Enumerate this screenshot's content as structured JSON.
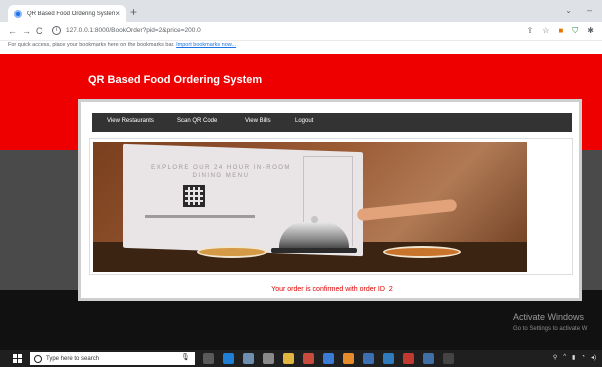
{
  "browser": {
    "tab_title": "QR Based Food Ordering System",
    "tab_close": "×",
    "new_tab": "+",
    "tab_search": "⌄",
    "window_minimize": "–",
    "url": "127.0.0.1:8000/BookOrder?pid=2&price=200.0",
    "info_glyph": "i",
    "bookmarks_hint": "For quick access, place your bookmarks here on the bookmarks bar.",
    "bookmarks_link": "Import bookmarks now..."
  },
  "site": {
    "title": "QR Based Food Ordering System"
  },
  "menu": [
    {
      "label": "View Restaurants"
    },
    {
      "label": "Scan QR Code"
    },
    {
      "label": "View Bills"
    },
    {
      "label": "Logout"
    }
  ],
  "banner": {
    "heading": "EXPLORE OUR 24 HOUR IN-ROOM DINING MENU"
  },
  "confirmation": {
    "message": "Your order is confirmed with order ID",
    "order_id": "2"
  },
  "watermark": {
    "title": "Activate Windows",
    "subtitle": "Go to Settings to activate W"
  },
  "taskbar": {
    "search_placeholder": "Type here to search"
  },
  "colors": {
    "header_red": "#ee0000",
    "menubar": "#333333",
    "confirm_text": "#e00000"
  }
}
